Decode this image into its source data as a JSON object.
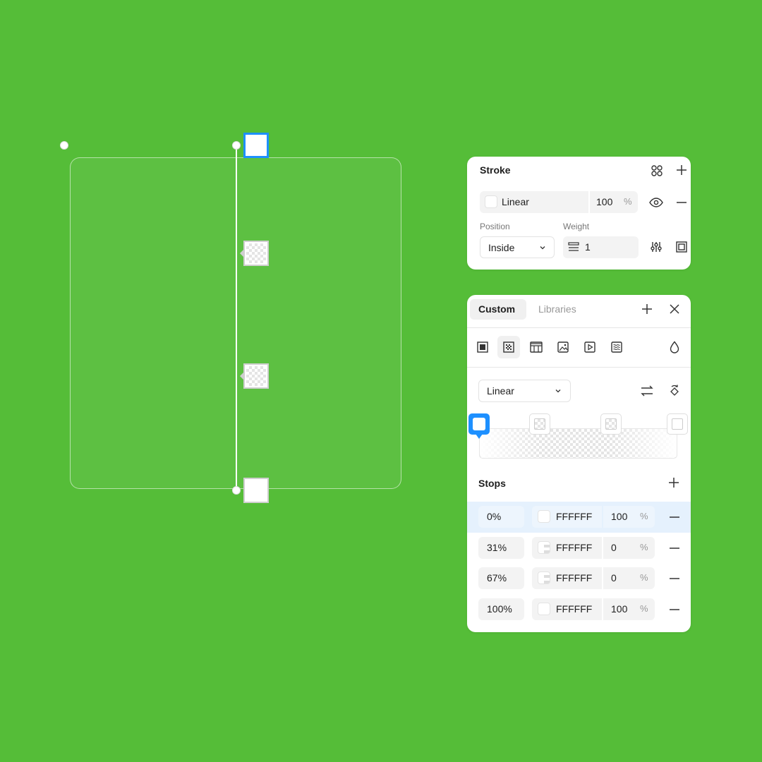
{
  "stroke_panel": {
    "title": "Stroke",
    "paint_type": "Linear",
    "opacity": "100",
    "percent": "%",
    "position_label": "Position",
    "position_value": "Inside",
    "weight_label": "Weight",
    "weight_value": "1"
  },
  "color_panel": {
    "tabs": [
      "Custom",
      "Libraries"
    ],
    "gradient_type": "Linear",
    "stops_title": "Stops",
    "stops": [
      {
        "position": "0%",
        "hex": "FFFFFF",
        "opacity": "100",
        "percent": "%"
      },
      {
        "position": "31%",
        "hex": "FFFFFF",
        "opacity": "0",
        "percent": "%"
      },
      {
        "position": "67%",
        "hex": "FFFFFF",
        "opacity": "0",
        "percent": "%"
      },
      {
        "position": "100%",
        "hex": "FFFFFF",
        "opacity": "100",
        "percent": "%"
      }
    ]
  },
  "colors": {
    "background": "#55bd38",
    "accent": "#1e90ff",
    "selected_row": "#e5f1fd"
  }
}
